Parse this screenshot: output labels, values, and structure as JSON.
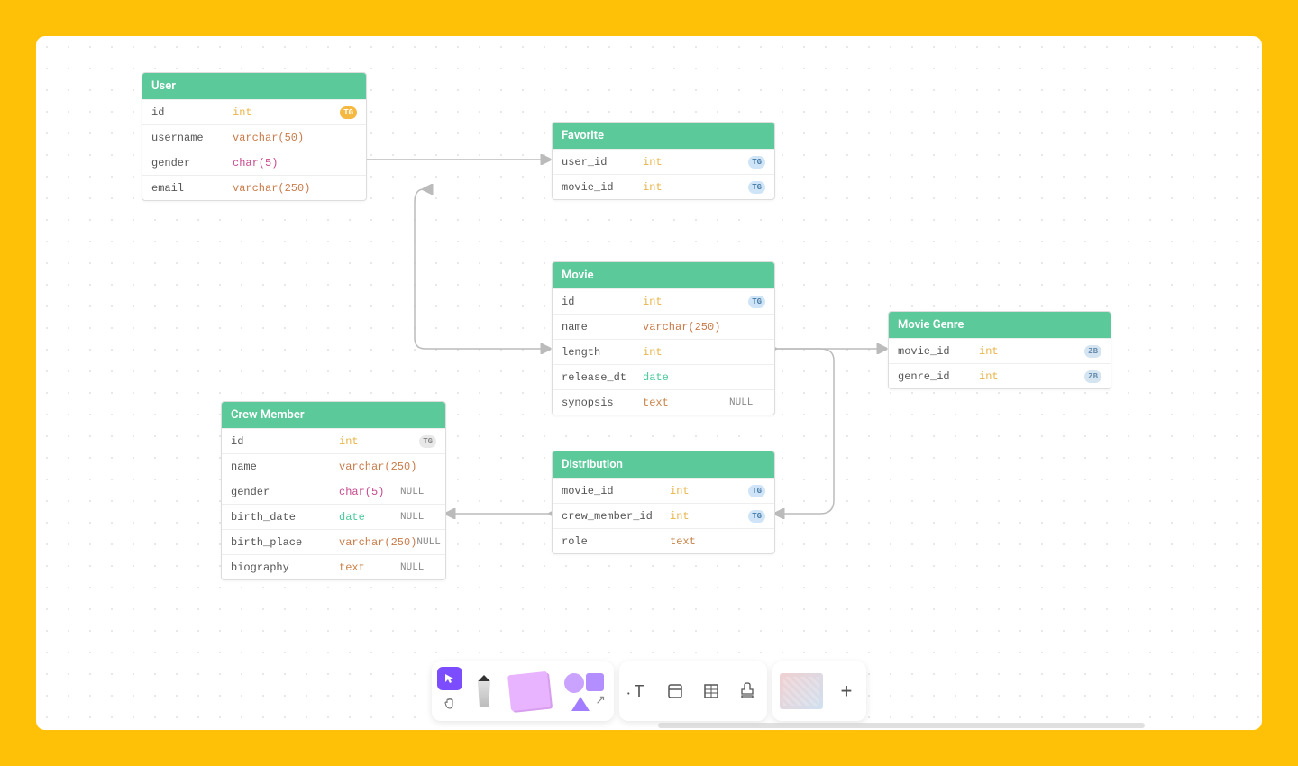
{
  "tables": {
    "user": {
      "title": "User",
      "rows": [
        {
          "name": "id",
          "type": "int",
          "type_class": "type-int",
          "badge": "TG",
          "badge_class": "badge-orange"
        },
        {
          "name": "username",
          "type": "varchar(50)",
          "type_class": "type-varchar"
        },
        {
          "name": "gender",
          "type": "char(5)",
          "type_class": "type-char"
        },
        {
          "name": "email",
          "type": "varchar(250)",
          "type_class": "type-varchar"
        }
      ]
    },
    "favorite": {
      "title": "Favorite",
      "rows": [
        {
          "name": "user_id",
          "type": "int",
          "type_class": "type-int",
          "badge": "TG",
          "badge_class": "badge-blue"
        },
        {
          "name": "movie_id",
          "type": "int",
          "type_class": "type-int",
          "badge": "TG",
          "badge_class": "badge-blue"
        }
      ]
    },
    "movie": {
      "title": "Movie",
      "rows": [
        {
          "name": "id",
          "type": "int",
          "type_class": "type-int",
          "badge": "TG",
          "badge_class": "badge-blue"
        },
        {
          "name": "name",
          "type": "varchar(250)",
          "type_class": "type-varchar"
        },
        {
          "name": "length",
          "type": "int",
          "type_class": "type-int"
        },
        {
          "name": "release_dt",
          "type": "date",
          "type_class": "type-date"
        },
        {
          "name": "synopsis",
          "type": "text",
          "type_class": "type-text",
          "nullable": "NULL"
        }
      ]
    },
    "movie_genre": {
      "title": "Movie Genre",
      "rows": [
        {
          "name": "movie_id",
          "type": "int",
          "type_class": "type-int",
          "badge": "ZB",
          "badge_class": "badge-lightblue"
        },
        {
          "name": "genre_id",
          "type": "int",
          "type_class": "type-int",
          "badge": "ZB",
          "badge_class": "badge-lightblue"
        }
      ]
    },
    "crew_member": {
      "title": "Crew Member",
      "rows": [
        {
          "name": "id",
          "type": "int",
          "type_class": "type-int",
          "badge": "TG",
          "badge_class": "badge-gray"
        },
        {
          "name": "name",
          "type": "varchar(250)",
          "type_class": "type-varchar"
        },
        {
          "name": "gender",
          "type": "char(5)",
          "type_class": "type-char",
          "nullable": "NULL"
        },
        {
          "name": "birth_date",
          "type": "date",
          "type_class": "type-date",
          "nullable": "NULL"
        },
        {
          "name": "birth_place",
          "type": "varchar(250)",
          "type_class": "type-varchar",
          "nullable": "NULL"
        },
        {
          "name": "biography",
          "type": "text",
          "type_class": "type-text",
          "nullable": "NULL"
        }
      ]
    },
    "distribution": {
      "title": "Distribution",
      "rows": [
        {
          "name": "movie_id",
          "type": "int",
          "type_class": "type-int",
          "badge": "TG",
          "badge_class": "badge-blue"
        },
        {
          "name": "crew_member_id",
          "type": "int",
          "type_class": "type-int",
          "badge": "TG",
          "badge_class": "badge-blue"
        },
        {
          "name": "role",
          "type": "text",
          "type_class": "type-text"
        }
      ]
    }
  },
  "toolbar": {
    "cursor": "cursor",
    "hand": "hand",
    "text": "T",
    "plus": "+"
  }
}
